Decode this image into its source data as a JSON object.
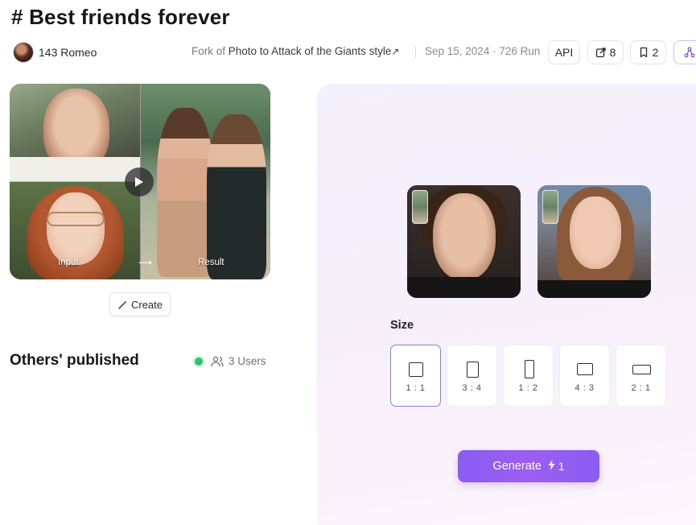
{
  "title": "# Best friends forever",
  "author": {
    "name": "143 Romeo",
    "avatar_icon": "user-avatar"
  },
  "fork": {
    "prefix": "Fork of",
    "link_text": "Photo to Attack of the Giants style",
    "link_icon": "external-link-icon"
  },
  "stats": {
    "date_runs": "Sep 15, 2024 · 726 Run"
  },
  "chips": {
    "api_label": "API",
    "share_count": "8",
    "bookmark_count": "2"
  },
  "preview": {
    "input_label": "Input",
    "result_label": "Result",
    "arrow": "⟶"
  },
  "create_button": {
    "label": "Create",
    "icon": "magic-wand-icon"
  },
  "others": {
    "title": "Others' published",
    "users_label": "3 Users",
    "status_color": "#2fbf71"
  },
  "size": {
    "label": "Size",
    "options": [
      {
        "ratio": "1 : 1",
        "selected": true
      },
      {
        "ratio": "3 : 4",
        "selected": false
      },
      {
        "ratio": "1 : 2",
        "selected": false
      },
      {
        "ratio": "4 : 3",
        "selected": false
      },
      {
        "ratio": "2 : 1",
        "selected": false
      }
    ]
  },
  "generate": {
    "label": "Generate",
    "cost": "1",
    "icon": "lightning-icon"
  },
  "colors": {
    "accent": "#8a5cf3",
    "selected_border": "#8e79e8"
  }
}
